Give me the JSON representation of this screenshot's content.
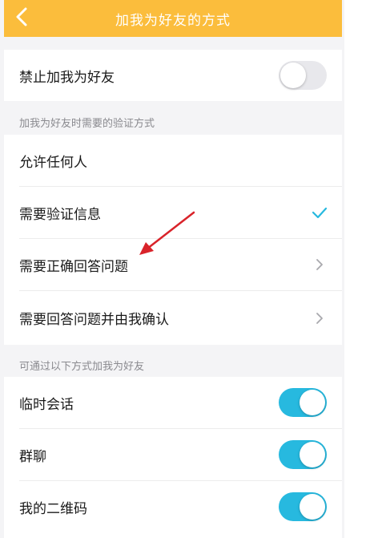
{
  "header": {
    "title": "加我为好友的方式"
  },
  "block_add": {
    "label": "禁止加我为好友",
    "toggle_on": false
  },
  "verify": {
    "header": "加我为好友时需要的验证方式",
    "options": [
      {
        "label": "允许任何人"
      },
      {
        "label": "需要验证信息",
        "selected": true
      },
      {
        "label": "需要正确回答问题"
      },
      {
        "label": "需要回答问题并由我确认"
      }
    ]
  },
  "sources": {
    "header": "可通过以下方式加我为好友",
    "items": [
      {
        "label": "临时会话",
        "toggle_on": true
      },
      {
        "label": "群聊",
        "toggle_on": true
      },
      {
        "label": "我的二维码",
        "toggle_on": true
      }
    ]
  },
  "colors": {
    "header_bg": "#fbbd3c",
    "toggle_on": "#27b9df",
    "check": "#27b9df",
    "annotation_arrow": "#d9232a"
  },
  "icons": {
    "back": "back-arrow-icon",
    "selected": "check-icon",
    "more": "chevron-right-icon"
  }
}
